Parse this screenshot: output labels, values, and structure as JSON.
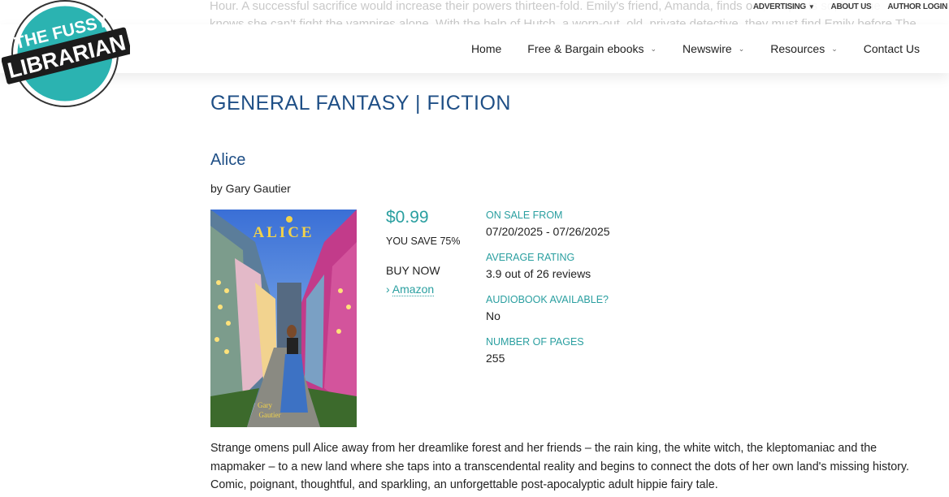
{
  "background_text": {
    "line1": "Hour. A successful sacrifice would increase their powers thirteen-fold. Emily's friend, Amanda, finds out, suspects so, but she",
    "line2": "knows she can't fight the vampires alone. With the help of Hutch, a worn-out, old, private detective, they must find Emily before The"
  },
  "topbar": {
    "advertising": "ADVERTISING",
    "about": "ABOUT US",
    "login": "AUTHOR LOGIN"
  },
  "logo": {
    "line1": "THE FUSSY",
    "line2": "LIBRARIAN"
  },
  "nav": {
    "home": "Home",
    "free": "Free & Bargain ebooks",
    "newswire": "Newswire",
    "resources": "Resources",
    "contact": "Contact Us"
  },
  "page": {
    "category": "GENERAL FANTASY | FICTION"
  },
  "book": {
    "title": "Alice",
    "byline": "by Gary Gautier",
    "cover_title": "ALICE",
    "cover_author_1": "Gary",
    "cover_author_2": "Gautier",
    "price": "$0.99",
    "save": "YOU SAVE 75%",
    "buy_now": "BUY NOW",
    "amazon": "Amazon",
    "description": "Strange omens pull Alice away from her dreamlike forest and her friends – the rain king, the white witch, the kleptomaniac and the mapmaker – to a new land where she taps into a transcendental reality and begins to connect the dots of her own land's missing history. Comic, poignant, thoughtful, and sparkling, an unforgettable post-apocalyptic adult hippie fairy tale."
  },
  "details": {
    "sale_label": "ON SALE FROM",
    "sale_value": "07/20/2025 - 07/26/2025",
    "rating_label": "AVERAGE RATING",
    "rating_value": "3.9 out of 26 reviews",
    "audio_label": "AUDIOBOOK AVAILABLE?",
    "audio_value": "No",
    "pages_label": "NUMBER OF PAGES",
    "pages_value": "255"
  },
  "colors": {
    "heading": "#1f4f86",
    "accent": "#2a9fa0",
    "logo_teal": "#2bb3b1"
  },
  "icons": {
    "chevron": "chevron-down-icon",
    "arrow": "chevron-right-icon"
  }
}
